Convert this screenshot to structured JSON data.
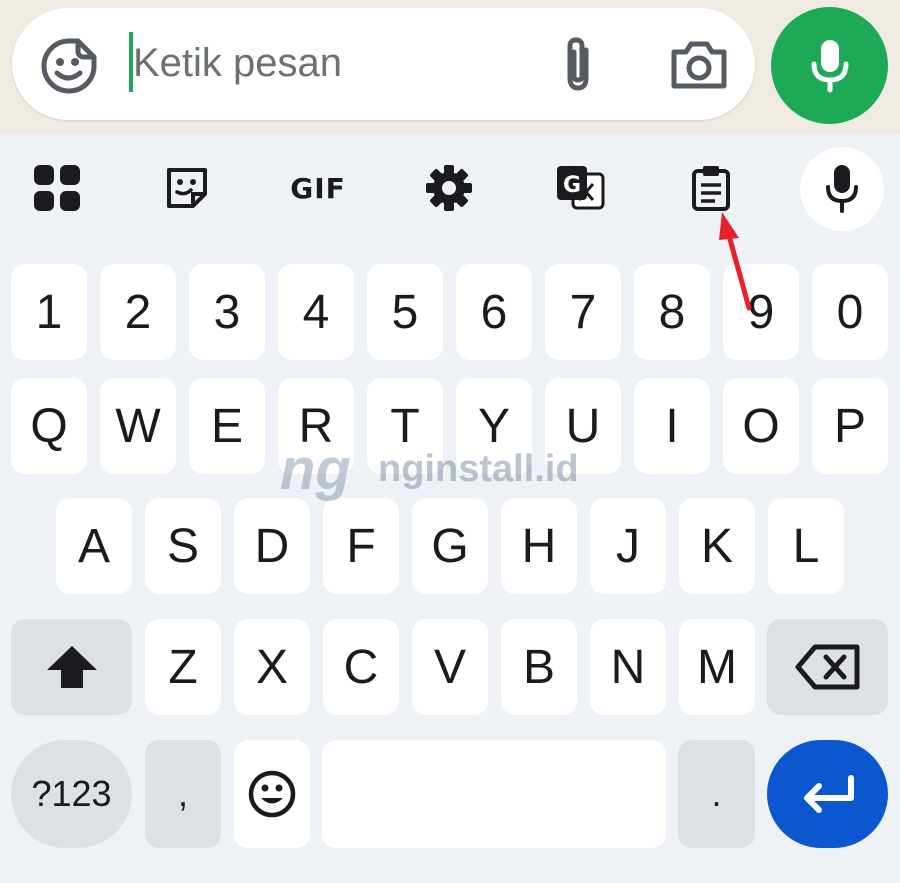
{
  "composer": {
    "placeholder": "Ketik pesan",
    "icons": [
      "sticker-emoji-icon",
      "attach-icon",
      "camera-icon",
      "microphone-icon"
    ],
    "mic_color": "#1ea956",
    "cursor_color": "#1faa59"
  },
  "toolbar": {
    "items": [
      {
        "name": "apps-grid-icon"
      },
      {
        "name": "sticker-icon"
      },
      {
        "name": "gif",
        "label": "GIF"
      },
      {
        "name": "settings-icon"
      },
      {
        "name": "translate-icon"
      },
      {
        "name": "clipboard-icon"
      },
      {
        "name": "voice-input-icon"
      }
    ]
  },
  "keyboard": {
    "row_numbers": [
      "1",
      "2",
      "3",
      "4",
      "5",
      "6",
      "7",
      "8",
      "9",
      "0"
    ],
    "row1": [
      "Q",
      "W",
      "E",
      "R",
      "T",
      "Y",
      "U",
      "I",
      "O",
      "P"
    ],
    "row2": [
      "A",
      "S",
      "D",
      "F",
      "G",
      "H",
      "J",
      "K",
      "L"
    ],
    "row3": [
      "Z",
      "X",
      "C",
      "V",
      "B",
      "N",
      "M"
    ],
    "shift_icon": "shift-arrow-icon",
    "backspace_icon": "backspace-icon",
    "symbols_label": "?123",
    "comma_label": ",",
    "emoji_icon": "smiley-icon",
    "period_label": ".",
    "enter_icon": "enter-arrow-icon",
    "enter_color": "#0b57d0"
  },
  "watermark": {
    "logo": "ng",
    "text": "nginstall.id"
  },
  "annotation": {
    "arrow_color": "#e8202a"
  }
}
